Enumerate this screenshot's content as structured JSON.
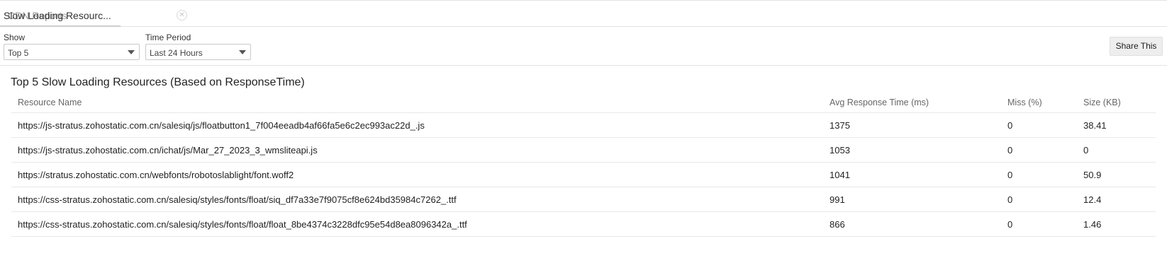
{
  "tabs": [
    {
      "label": "CDN Reports"
    },
    {
      "label": "Slow Loading Resourc..."
    }
  ],
  "filters": {
    "show_label": "Show",
    "show_value": "Top 5",
    "period_label": "Time Period",
    "period_value": "Last 24 Hours",
    "share_label": "Share This"
  },
  "report": {
    "title": "Top 5 Slow Loading Resources (Based on ResponseTime)",
    "columns": [
      "Resource Name",
      "Avg Response Time (ms)",
      "Miss (%)",
      "Size (KB)"
    ],
    "rows": [
      [
        "https://js-stratus.zohostatic.com.cn/salesiq/js/floatbutton1_7f004eeadb4af66fa5e6c2ec993ac22d_.js",
        "1375",
        "0",
        "38.41"
      ],
      [
        "https://js-stratus.zohostatic.com.cn/ichat/js/Mar_27_2023_3_wmsliteapi.js",
        "1053",
        "0",
        "0"
      ],
      [
        "https://stratus.zohostatic.com.cn/webfonts/robotoslablight/font.woff2",
        "1041",
        "0",
        "50.9"
      ],
      [
        "https://css-stratus.zohostatic.com.cn/salesiq/styles/fonts/float/siq_df7a33e7f9075cf8e624bd35984c7262_.ttf",
        "991",
        "0",
        "12.4"
      ],
      [
        "https://css-stratus.zohostatic.com.cn/salesiq/styles/fonts/float/float_8be4374c3228dfc95e54d8ea8096342a_.ttf",
        "866",
        "0",
        "1.46"
      ]
    ]
  }
}
